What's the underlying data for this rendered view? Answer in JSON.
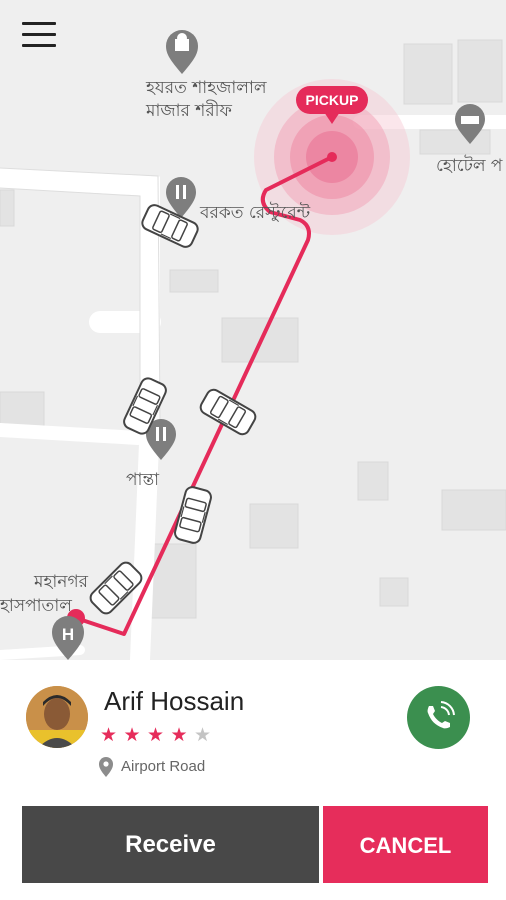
{
  "map": {
    "pickup_label": "PICKUP",
    "pois": [
      {
        "id": "mazar",
        "line1": "হযরত শাহজালাল",
        "line2": "মাজার শরীফ"
      },
      {
        "id": "restaurant",
        "text": "বরকত রেস্টুরেন্ট"
      },
      {
        "id": "hotel",
        "text": "হোটেল প"
      },
      {
        "id": "panta",
        "text": "পান্তা"
      },
      {
        "id": "hospital",
        "line1": "মহানগর",
        "line2": "হাসপাতাল"
      }
    ],
    "route_color": "#e52b5a"
  },
  "driver": {
    "name": "Arif Hossain",
    "rating": 4,
    "rating_max": 5,
    "location": "Airport Road"
  },
  "actions": {
    "receive_label": "Receive",
    "cancel_label": "CANCEL"
  },
  "colors": {
    "accent": "#e62d5b",
    "call": "#3b8f4f",
    "receive_bg": "#484848"
  }
}
